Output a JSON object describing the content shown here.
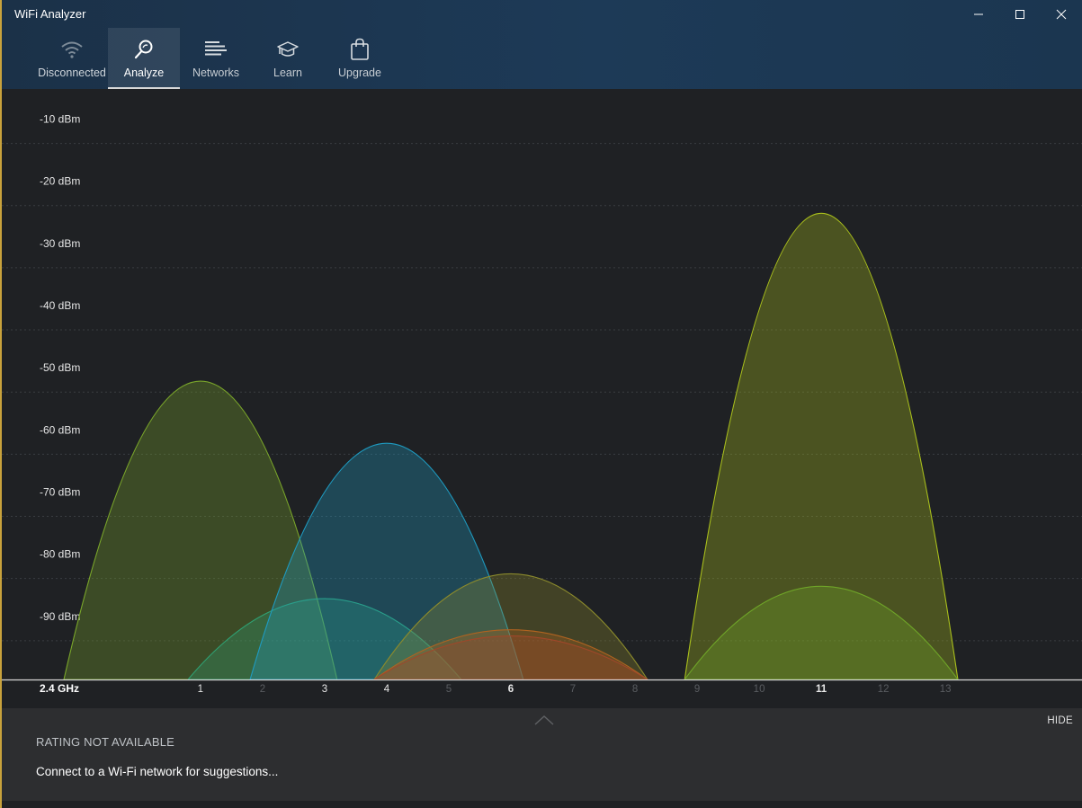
{
  "window": {
    "title": "WiFi Analyzer"
  },
  "nav": {
    "items": [
      {
        "label": "Disconnected",
        "icon": "wifi-icon",
        "active": false
      },
      {
        "label": "Analyze",
        "icon": "analyze-icon",
        "active": true
      },
      {
        "label": "Networks",
        "icon": "networks-icon",
        "active": false
      },
      {
        "label": "Learn",
        "icon": "graduation-cap-icon",
        "active": false
      },
      {
        "label": "Upgrade",
        "icon": "shopping-bag-icon",
        "active": false
      }
    ]
  },
  "chart": {
    "band_label": "2.4 GHz",
    "y_labels": [
      "-10 dBm",
      "-20 dBm",
      "-30 dBm",
      "-40 dBm",
      "-50 dBm",
      "-60 dBm",
      "-70 dBm",
      "-80 dBm",
      "-90 dBm"
    ],
    "channels": [
      "1",
      "2",
      "3",
      "4",
      "5",
      "6",
      "7",
      "8",
      "9",
      "10",
      "11",
      "12",
      "13"
    ]
  },
  "chart_data": {
    "type": "area",
    "xlabel": "2.4 GHz",
    "ylabel": "",
    "ylim": [
      -100,
      -5
    ],
    "xlim": [
      -2.2,
      15.2
    ],
    "x_ticks": [
      1,
      2,
      3,
      4,
      5,
      6,
      7,
      8,
      9,
      10,
      11,
      12,
      13
    ],
    "highlighted_channels": [
      1,
      3,
      4,
      6,
      11
    ],
    "series": [
      {
        "channel": 1,
        "peak_dbm": -52,
        "width_channels": 4.4,
        "color": "#7aa62a"
      },
      {
        "channel": 3,
        "peak_dbm": -87,
        "width_channels": 4.4,
        "color": "#2fa072"
      },
      {
        "channel": 4,
        "peak_dbm": -62,
        "width_channels": 4.4,
        "color": "#1e9bc1"
      },
      {
        "channel": 6,
        "peak_dbm": -83,
        "width_channels": 4.4,
        "color": "#8b8a2c"
      },
      {
        "channel": 6,
        "peak_dbm": -92,
        "width_channels": 4.4,
        "color": "#b06320"
      },
      {
        "channel": 6,
        "peak_dbm": -93,
        "width_channels": 4.4,
        "color": "#a0472a"
      },
      {
        "channel": 11,
        "peak_dbm": -25,
        "width_channels": 4.4,
        "color": "#a9bf1c"
      },
      {
        "channel": 11,
        "peak_dbm": -85,
        "width_channels": 4.4,
        "color": "#6fa528"
      }
    ],
    "grid": true
  },
  "panel": {
    "hide_label": "HIDE",
    "rating": "RATING NOT AVAILABLE",
    "suggestion": "Connect to a Wi-Fi network for suggestions..."
  },
  "colors": {
    "header_bg": "#1d3a57",
    "chart_bg": "#1f2124",
    "panel_bg": "#2d2e30",
    "accent_border": "#c8a23c"
  }
}
